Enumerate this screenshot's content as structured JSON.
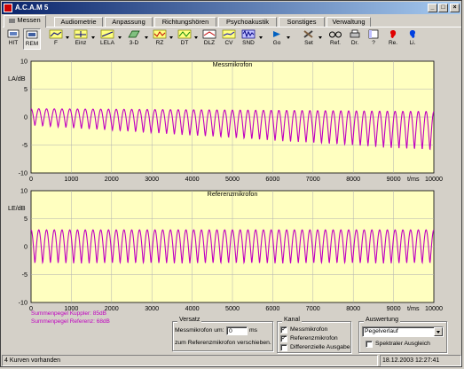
{
  "window": {
    "title": "A.C.A.M 5"
  },
  "tabs": [
    {
      "label": "Messen"
    },
    {
      "label": "Audiometrie"
    },
    {
      "label": "Anpassung"
    },
    {
      "label": "Richtungshören"
    },
    {
      "label": "Psychoakustik"
    },
    {
      "label": "Sonstiges"
    },
    {
      "label": "Verwaltung"
    }
  ],
  "toolbar": [
    {
      "label": "HIT",
      "icon": "hit-icon"
    },
    {
      "label": "REM",
      "icon": "rem-icon"
    },
    {
      "label": "F",
      "icon": "frequency-curve-icon"
    },
    {
      "label": "Einz",
      "icon": "single-curve-icon"
    },
    {
      "label": "LELA",
      "icon": "lela-icon"
    },
    {
      "label": "3-D",
      "icon": "3d-icon"
    },
    {
      "label": "RZ",
      "icon": "rz-icon"
    },
    {
      "label": "DT",
      "icon": "dt-icon"
    },
    {
      "label": "DLZ",
      "icon": "dlz-icon"
    },
    {
      "label": "CV",
      "icon": "cv-icon"
    },
    {
      "label": "SND",
      "icon": "sound-icon"
    },
    {
      "label": "Go",
      "icon": "go-icon"
    },
    {
      "label": "Set",
      "icon": "settings-icon"
    },
    {
      "label": "Ref.",
      "icon": "reference-glasses-icon"
    },
    {
      "label": "Dr.",
      "icon": "printer-icon"
    },
    {
      "label": "?",
      "icon": "help-icon"
    },
    {
      "label": "Re.",
      "icon": "right-ear-icon"
    },
    {
      "label": "Li.",
      "icon": "left-ear-icon"
    }
  ],
  "chart_data": [
    {
      "type": "line",
      "title": "Messmikrofon",
      "xlabel": "t/ms",
      "ylabel": "LA/dB",
      "xlim": [
        0,
        10000
      ],
      "ylim": [
        -10,
        10
      ],
      "x_ticks": [
        0,
        1000,
        2000,
        3000,
        4000,
        5000,
        6000,
        7000,
        8000,
        9000,
        10000
      ],
      "y_ticks": [
        10,
        5,
        0,
        -5,
        -10
      ],
      "grid": true,
      "series": [
        {
          "color": "#c000c0",
          "waveform": "periodic",
          "cycles": 52,
          "max_start": 1.5,
          "min_start": -1.5,
          "max_end": 1.0,
          "min_end": -6.0
        }
      ],
      "background": "#ffffc0"
    },
    {
      "type": "line",
      "title": "Referenzmikrofon",
      "xlabel": "t/ms",
      "ylabel": "LE/dB",
      "xlim": [
        0,
        10000
      ],
      "ylim": [
        -10,
        10
      ],
      "x_ticks": [
        0,
        1000,
        2000,
        3000,
        4000,
        5000,
        6000,
        7000,
        8000,
        9000,
        10000
      ],
      "y_ticks": [
        10,
        5,
        0,
        -5,
        -10
      ],
      "grid": true,
      "series": [
        {
          "color": "#c000c0",
          "waveform": "periodic",
          "cycles": 52,
          "max": 3.0,
          "min": -3.0
        }
      ],
      "background": "#ffffc0"
    }
  ],
  "levels": {
    "kuppler": "Summenpegel Kuppler: 85dB",
    "referenz": "Summenpegel Referenz: 68dB"
  },
  "versatz": {
    "title": "Versatz",
    "label_pre": "Messmikrofon um:",
    "value": "0",
    "unit": "ms",
    "label_post": "zum Referenzmikrofon verschieben."
  },
  "kanal": {
    "title": "Kanal",
    "items": [
      {
        "label": "Messmikrofon",
        "checked": true
      },
      {
        "label": "Referenzmikrofon",
        "checked": true
      },
      {
        "label": "Differenzielle Ausgabe",
        "checked": false
      }
    ]
  },
  "auswertung": {
    "title": "Auswertung",
    "selected": "Pegelverlauf",
    "spektral_label": "Spektraler Ausgleich",
    "spektral_checked": false
  },
  "status": {
    "left": "4 Kurven vorhanden",
    "right": "18.12.2003 12:27:41"
  }
}
